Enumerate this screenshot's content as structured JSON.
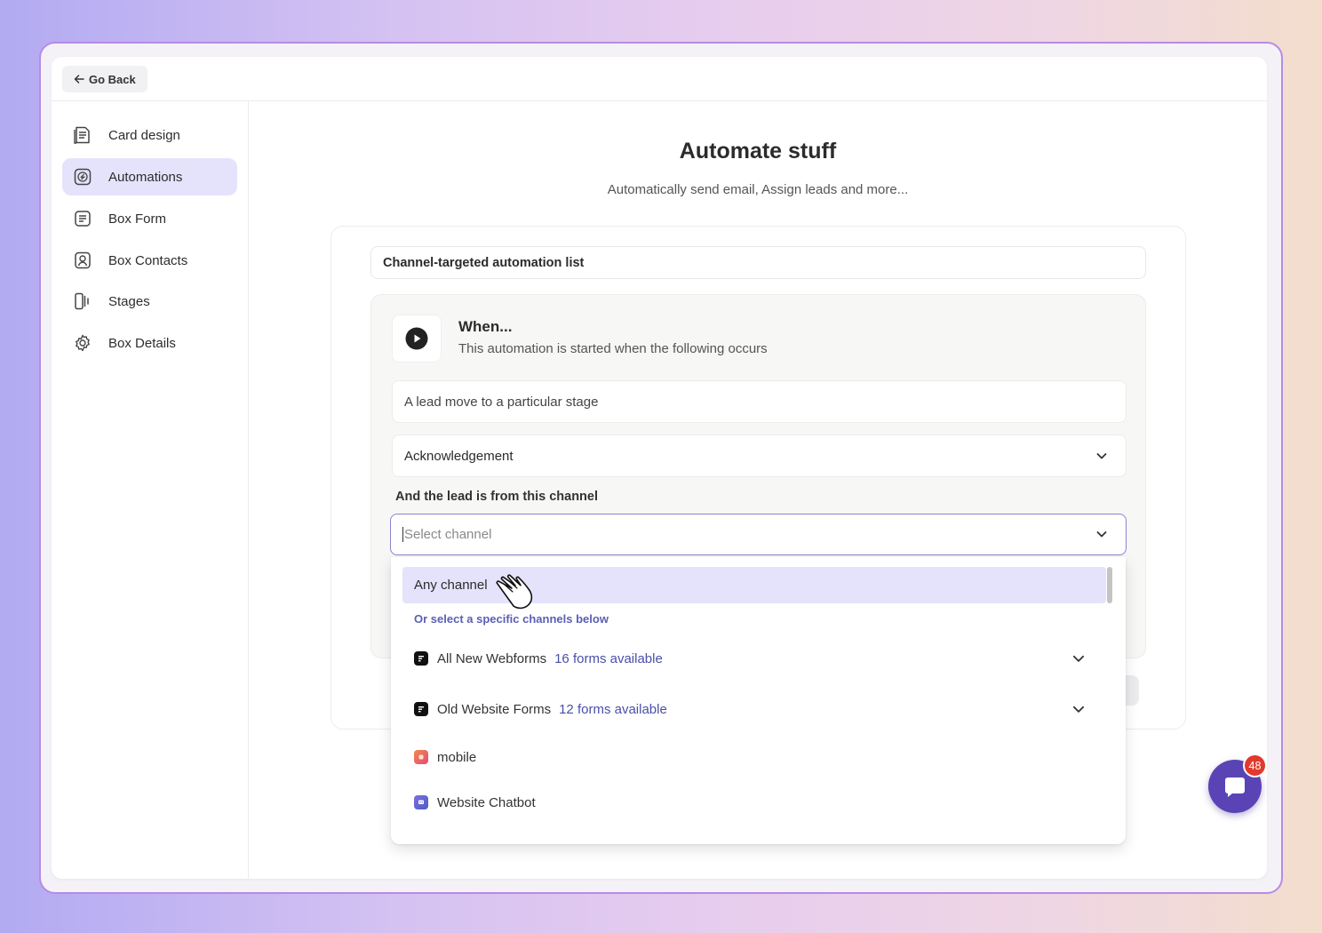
{
  "topbar": {
    "back_label": "Go Back"
  },
  "sidebar": {
    "items": [
      {
        "label": "Card design",
        "icon": "card-design-icon",
        "active": false
      },
      {
        "label": "Automations",
        "icon": "automation-icon",
        "active": true
      },
      {
        "label": "Box Form",
        "icon": "form-icon",
        "active": false
      },
      {
        "label": "Box Contacts",
        "icon": "contacts-icon",
        "active": false
      },
      {
        "label": "Stages",
        "icon": "stages-icon",
        "active": false
      },
      {
        "label": "Box Details",
        "icon": "gear-icon",
        "active": false
      }
    ]
  },
  "main": {
    "title": "Automate stuff",
    "subtitle": "Automatically send email, Assign leads and more...",
    "list_label": "Channel-targeted automation list",
    "trigger": {
      "title": "When...",
      "subtitle": "This automation is started when the following occurs",
      "event_value": "A lead move to a particular stage",
      "stage_value": "Acknowledgement",
      "channel_label": "And the lead is from this channel",
      "channel_placeholder": "Select channel"
    }
  },
  "dropdown": {
    "any_label": "Any channel",
    "hint": "Or select a specific channels below",
    "groups": [
      {
        "label": "All New Webforms",
        "count": "16 forms available",
        "icon": "webform-icon",
        "color": "#111111"
      },
      {
        "label": "Old Website Forms",
        "count": "12 forms available",
        "icon": "webform-icon",
        "color": "#111111"
      }
    ],
    "channels": [
      {
        "label": "mobile",
        "icon": "mobile-icon",
        "color": "#ef6a5b"
      },
      {
        "label": "Website Chatbot",
        "icon": "chatbot-icon",
        "color": "#5d5fc7"
      }
    ]
  },
  "chat": {
    "badge": "48",
    "icon": "chat-bubble-icon",
    "color": "#5a44b5"
  }
}
